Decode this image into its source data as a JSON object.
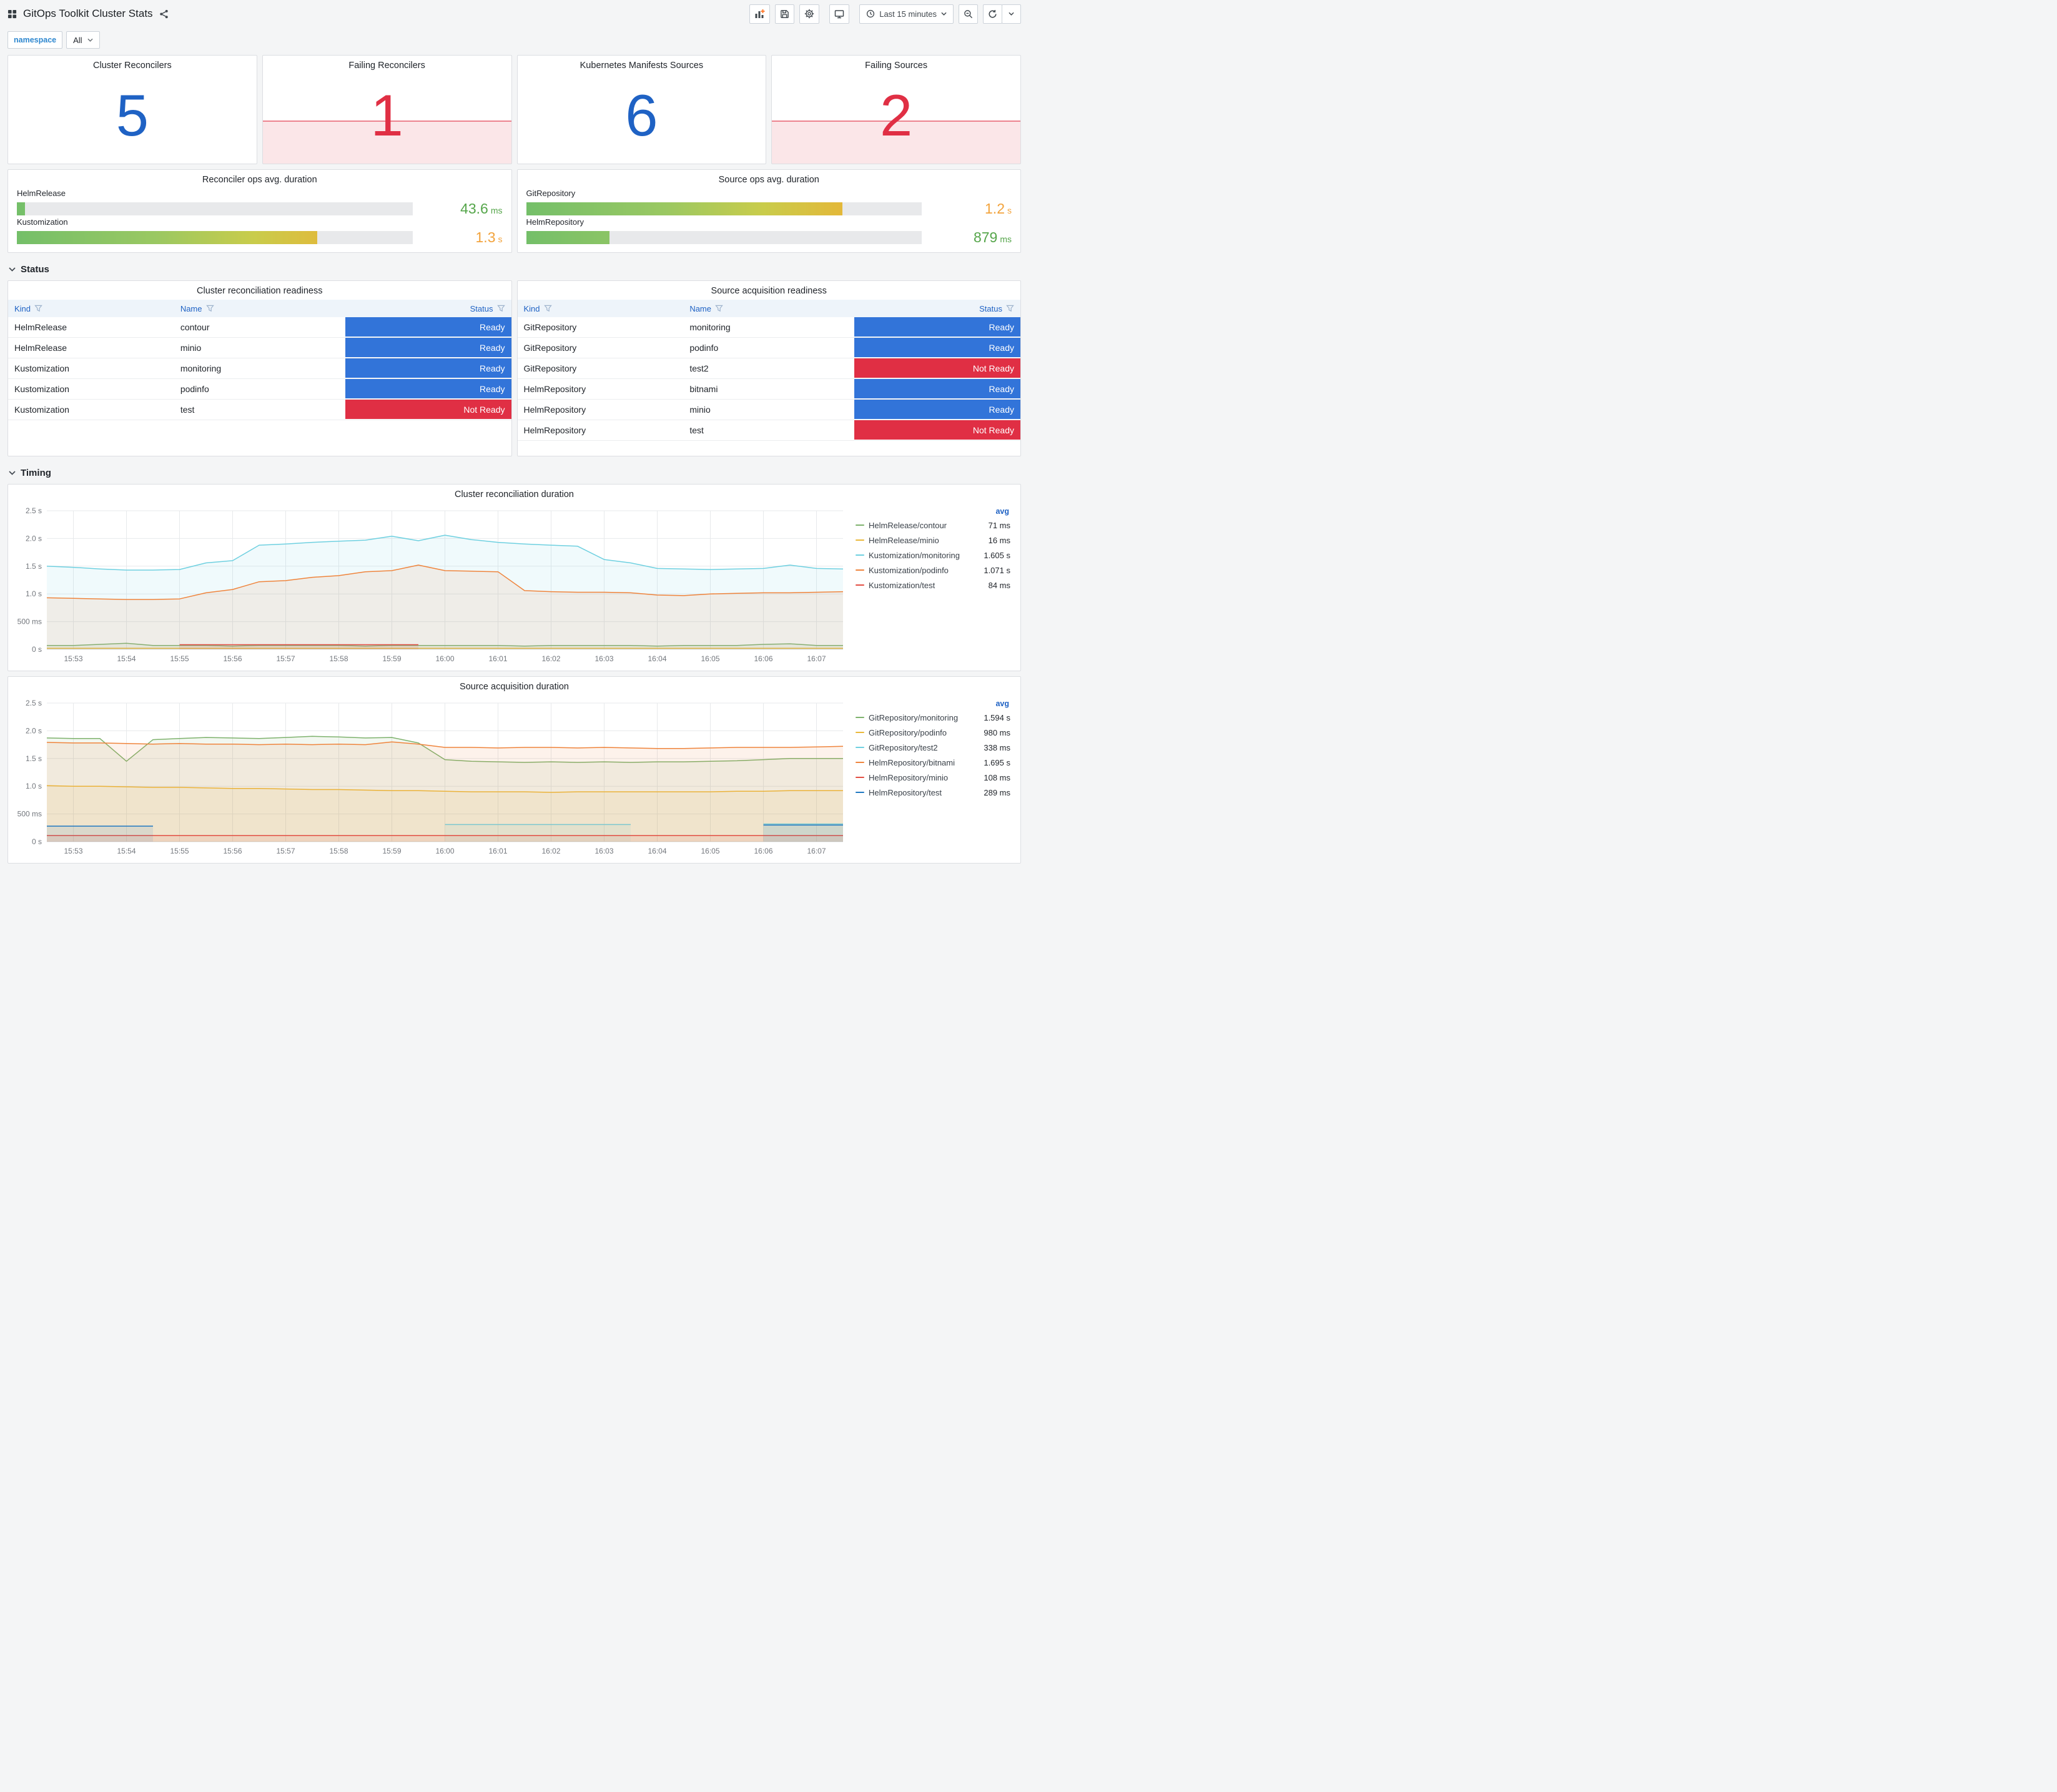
{
  "header": {
    "title": "GitOps Toolkit Cluster Stats",
    "time_range": "Last 15 minutes"
  },
  "variables": {
    "namespace_label": "namespace",
    "namespace_value": "All"
  },
  "sections": {
    "status": "Status",
    "timing": "Timing"
  },
  "colors": {
    "stat_ok": "#1F62C4",
    "stat_alert": "#E02F44",
    "ready_cell": "#3274D9",
    "not_ready_cell": "#E02F44"
  },
  "stats": [
    {
      "title": "Cluster Reconcilers",
      "value": "5",
      "state": "ok"
    },
    {
      "title": "Failing Reconcilers",
      "value": "1",
      "state": "alert"
    },
    {
      "title": "Kubernetes Manifests Sources",
      "value": "6",
      "state": "ok"
    },
    {
      "title": "Failing Sources",
      "value": "2",
      "state": "alert"
    }
  ],
  "gauges": [
    {
      "title": "Reconciler ops avg. duration",
      "rows": [
        {
          "label": "HelmRelease",
          "value": "43.6",
          "unit": "ms",
          "pct": 2,
          "color": "#56A64B"
        },
        {
          "label": "Kustomization",
          "value": "1.3",
          "unit": "s",
          "pct": 76,
          "color": "#F2A33C"
        }
      ]
    },
    {
      "title": "Source ops avg. duration",
      "rows": [
        {
          "label": "GitRepository",
          "value": "1.2",
          "unit": "s",
          "pct": 80,
          "color": "#F2A33C"
        },
        {
          "label": "HelmRepository",
          "value": "879",
          "unit": "ms",
          "pct": 21,
          "color": "#56A64B"
        }
      ]
    }
  ],
  "tables": [
    {
      "title": "Cluster reconciliation readiness",
      "columns": [
        "Kind",
        "Name",
        "Status"
      ],
      "rows": [
        {
          "kind": "HelmRelease",
          "name": "contour",
          "status": "Ready"
        },
        {
          "kind": "HelmRelease",
          "name": "minio",
          "status": "Ready"
        },
        {
          "kind": "Kustomization",
          "name": "monitoring",
          "status": "Ready"
        },
        {
          "kind": "Kustomization",
          "name": "podinfo",
          "status": "Ready"
        },
        {
          "kind": "Kustomization",
          "name": "test",
          "status": "Not Ready"
        }
      ]
    },
    {
      "title": "Source acquisition readiness",
      "columns": [
        "Kind",
        "Name",
        "Status"
      ],
      "rows": [
        {
          "kind": "GitRepository",
          "name": "monitoring",
          "status": "Ready"
        },
        {
          "kind": "GitRepository",
          "name": "podinfo",
          "status": "Ready"
        },
        {
          "kind": "GitRepository",
          "name": "test2",
          "status": "Not Ready"
        },
        {
          "kind": "HelmRepository",
          "name": "bitnami",
          "status": "Ready"
        },
        {
          "kind": "HelmRepository",
          "name": "minio",
          "status": "Ready"
        },
        {
          "kind": "HelmRepository",
          "name": "test",
          "status": "Not Ready"
        }
      ]
    }
  ],
  "chart_data": [
    {
      "type": "line",
      "title": "Cluster reconciliation duration",
      "legend_header": "avg",
      "x_max": 15,
      "dt": 0.5,
      "ylim": [
        0,
        2.5
      ],
      "x_ticks": [
        "15:53",
        "15:54",
        "15:55",
        "15:56",
        "15:57",
        "15:58",
        "15:59",
        "16:00",
        "16:01",
        "16:02",
        "16:03",
        "16:04",
        "16:05",
        "16:06",
        "16:07"
      ],
      "y_ticks": [
        {
          "v": 0,
          "label": "0 s"
        },
        {
          "v": 0.5,
          "label": "500 ms"
        },
        {
          "v": 1,
          "label": "1.0 s"
        },
        {
          "v": 1.5,
          "label": "1.5 s"
        },
        {
          "v": 2,
          "label": "2.0 s"
        },
        {
          "v": 2.5,
          "label": "2.5 s"
        }
      ],
      "series": [
        {
          "name": "HelmRelease/contour",
          "avg": "71 ms",
          "color": "#7EB26D",
          "values": [
            0.07,
            0.07,
            0.09,
            0.11,
            0.07,
            0.07,
            0.07,
            0.06,
            0.07,
            0.07,
            0.07,
            0.07,
            0.06,
            0.07,
            0.07,
            0.07,
            0.07,
            0.07,
            0.06,
            0.07,
            0.07,
            0.07,
            0.07,
            0.06,
            0.07,
            0.07,
            0.07,
            0.09,
            0.1,
            0.07,
            0.07
          ]
        },
        {
          "name": "HelmRelease/minio",
          "avg": "16 ms",
          "color": "#EAB839",
          "values": [
            0.02,
            0.02,
            0.02,
            0.02,
            0.02,
            0.02,
            0.02,
            0.02,
            0.02,
            0.02,
            0.02,
            0.02,
            0.02,
            0.02,
            0.02,
            0.02,
            0.02,
            0.02,
            0.02,
            0.02,
            0.02,
            0.02,
            0.02,
            0.02,
            0.02,
            0.02,
            0.02,
            0.02,
            0.02,
            0.02,
            0.02
          ]
        },
        {
          "name": "Kustomization/monitoring",
          "avg": "1.605 s",
          "color": "#6ED0E0",
          "values": [
            1.5,
            1.48,
            1.45,
            1.43,
            1.43,
            1.44,
            1.56,
            1.6,
            1.88,
            1.9,
            1.93,
            1.95,
            1.97,
            2.04,
            1.96,
            2.06,
            1.98,
            1.93,
            1.9,
            1.88,
            1.86,
            1.62,
            1.56,
            1.46,
            1.45,
            1.44,
            1.45,
            1.46,
            1.52,
            1.46,
            1.45
          ]
        },
        {
          "name": "Kustomization/podinfo",
          "avg": "1.071 s",
          "color": "#EF843C",
          "values": [
            0.93,
            0.92,
            0.91,
            0.9,
            0.9,
            0.91,
            1.02,
            1.08,
            1.22,
            1.24,
            1.3,
            1.33,
            1.4,
            1.42,
            1.52,
            1.42,
            1.41,
            1.4,
            1.06,
            1.04,
            1.03,
            1.03,
            1.02,
            0.98,
            0.97,
            1.0,
            1.01,
            1.02,
            1.02,
            1.03,
            1.04
          ]
        },
        {
          "name": "Kustomization/test",
          "avg": "84 ms",
          "color": "#E24D42",
          "values": [
            null,
            null,
            null,
            null,
            null,
            0.085,
            0.085,
            0.085,
            0.085,
            0.085,
            0.085,
            0.085,
            0.085,
            0.085,
            0.085,
            null,
            null,
            null,
            null,
            null,
            null,
            null,
            null,
            null,
            null,
            null,
            null,
            null,
            null,
            null,
            null
          ]
        }
      ]
    },
    {
      "type": "line",
      "title": "Source acquisition duration",
      "legend_header": "avg",
      "x_max": 15,
      "dt": 0.5,
      "ylim": [
        0,
        2.5
      ],
      "x_ticks": [
        "15:53",
        "15:54",
        "15:55",
        "15:56",
        "15:57",
        "15:58",
        "15:59",
        "16:00",
        "16:01",
        "16:02",
        "16:03",
        "16:04",
        "16:05",
        "16:06",
        "16:07"
      ],
      "y_ticks": [
        {
          "v": 0,
          "label": "0 s"
        },
        {
          "v": 0.5,
          "label": "500 ms"
        },
        {
          "v": 1,
          "label": "1.0 s"
        },
        {
          "v": 1.5,
          "label": "1.5 s"
        },
        {
          "v": 2,
          "label": "2.0 s"
        },
        {
          "v": 2.5,
          "label": "2.5 s"
        }
      ],
      "series": [
        {
          "name": "GitRepository/monitoring",
          "avg": "1.594 s",
          "color": "#7EB26D",
          "values": [
            1.87,
            1.86,
            1.86,
            1.45,
            1.84,
            1.86,
            1.88,
            1.87,
            1.86,
            1.88,
            1.9,
            1.89,
            1.87,
            1.88,
            1.78,
            1.48,
            1.45,
            1.44,
            1.43,
            1.44,
            1.43,
            1.44,
            1.43,
            1.44,
            1.44,
            1.45,
            1.46,
            1.48,
            1.5,
            1.5,
            1.5
          ]
        },
        {
          "name": "GitRepository/podinfo",
          "avg": "980 ms",
          "color": "#EAB839",
          "values": [
            1.01,
            1.0,
            1.0,
            0.99,
            0.98,
            0.98,
            0.97,
            0.96,
            0.96,
            0.95,
            0.94,
            0.94,
            0.93,
            0.92,
            0.92,
            0.91,
            0.9,
            0.9,
            0.9,
            0.89,
            0.9,
            0.9,
            0.9,
            0.9,
            0.9,
            0.9,
            0.91,
            0.91,
            0.92,
            0.92,
            0.92
          ]
        },
        {
          "name": "GitRepository/test2",
          "avg": "338 ms",
          "color": "#6ED0E0",
          "values": [
            null,
            null,
            null,
            null,
            null,
            null,
            null,
            null,
            null,
            null,
            null,
            null,
            null,
            null,
            null,
            0.31,
            0.31,
            0.31,
            0.31,
            0.31,
            0.31,
            0.31,
            0.31,
            null,
            null,
            null,
            null,
            0.32,
            0.32,
            0.32,
            0.32
          ]
        },
        {
          "name": "HelmRepository/bitnami",
          "avg": "1.695 s",
          "color": "#EF843C",
          "values": [
            1.79,
            1.78,
            1.78,
            1.77,
            1.76,
            1.77,
            1.76,
            1.76,
            1.75,
            1.76,
            1.75,
            1.76,
            1.75,
            1.8,
            1.76,
            1.7,
            1.7,
            1.69,
            1.7,
            1.7,
            1.69,
            1.7,
            1.69,
            1.68,
            1.68,
            1.69,
            1.7,
            1.7,
            1.7,
            1.71,
            1.72
          ]
        },
        {
          "name": "HelmRepository/minio",
          "avg": "108 ms",
          "color": "#E24D42",
          "values": [
            0.11,
            0.11,
            0.11,
            0.11,
            0.11,
            0.11,
            0.11,
            0.11,
            0.11,
            0.11,
            0.11,
            0.11,
            0.11,
            0.11,
            0.11,
            0.11,
            0.11,
            0.11,
            0.11,
            0.11,
            0.11,
            0.11,
            0.11,
            0.11,
            0.11,
            0.11,
            0.11,
            0.11,
            0.11,
            0.11,
            0.11
          ]
        },
        {
          "name": "HelmRepository/test",
          "avg": "289 ms",
          "color": "#1F78C1",
          "values": [
            0.28,
            0.28,
            0.28,
            0.28,
            0.28,
            null,
            null,
            null,
            null,
            null,
            null,
            null,
            null,
            null,
            null,
            null,
            null,
            null,
            null,
            null,
            null,
            null,
            null,
            null,
            null,
            null,
            null,
            0.3,
            0.3,
            0.3,
            0.3
          ]
        }
      ]
    }
  ]
}
